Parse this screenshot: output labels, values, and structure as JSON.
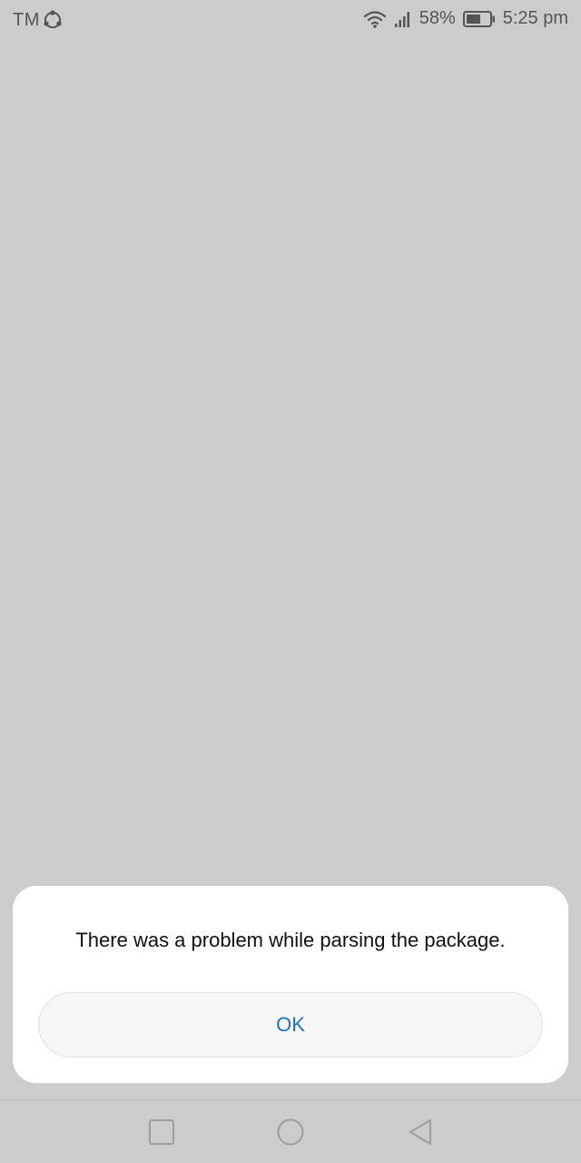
{
  "status_bar": {
    "carrier": "TM",
    "battery_percent": "58%",
    "time": "5:25 pm",
    "icons": [
      "sync-icon",
      "wifi-icon",
      "signal-icon",
      "battery-icon"
    ]
  },
  "dialog": {
    "message": "There was a problem while parsing the package.",
    "ok_label": "OK"
  },
  "nav_bar": {
    "icons": [
      "recent-apps-icon",
      "home-icon",
      "back-icon"
    ]
  },
  "colors": {
    "background": "#cccccc",
    "dialog": "#ffffff",
    "accent": "#1a73c8"
  }
}
